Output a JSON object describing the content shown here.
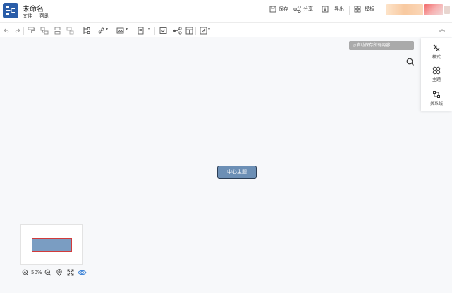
{
  "app": {
    "title": "未命名"
  },
  "menu": [
    {
      "label": "文件"
    },
    {
      "label": "帮助"
    }
  ],
  "header_actions": {
    "save": "保存",
    "share": "分享",
    "export": "导出",
    "template": "模板"
  },
  "autosave": {
    "text": "◎自动保存所有内容"
  },
  "right_panel": {
    "items": [
      {
        "label": "样式"
      },
      {
        "label": "主题"
      },
      {
        "label": "关系线"
      }
    ]
  },
  "canvas": {
    "central_topic": "中心主题"
  },
  "zoom": {
    "level": "50%"
  },
  "colors": {
    "accent": "#2a5da8",
    "node_fill": "#6c8fb5",
    "node_border": "#2c3e55",
    "minimap_outline": "#d23b3b"
  }
}
